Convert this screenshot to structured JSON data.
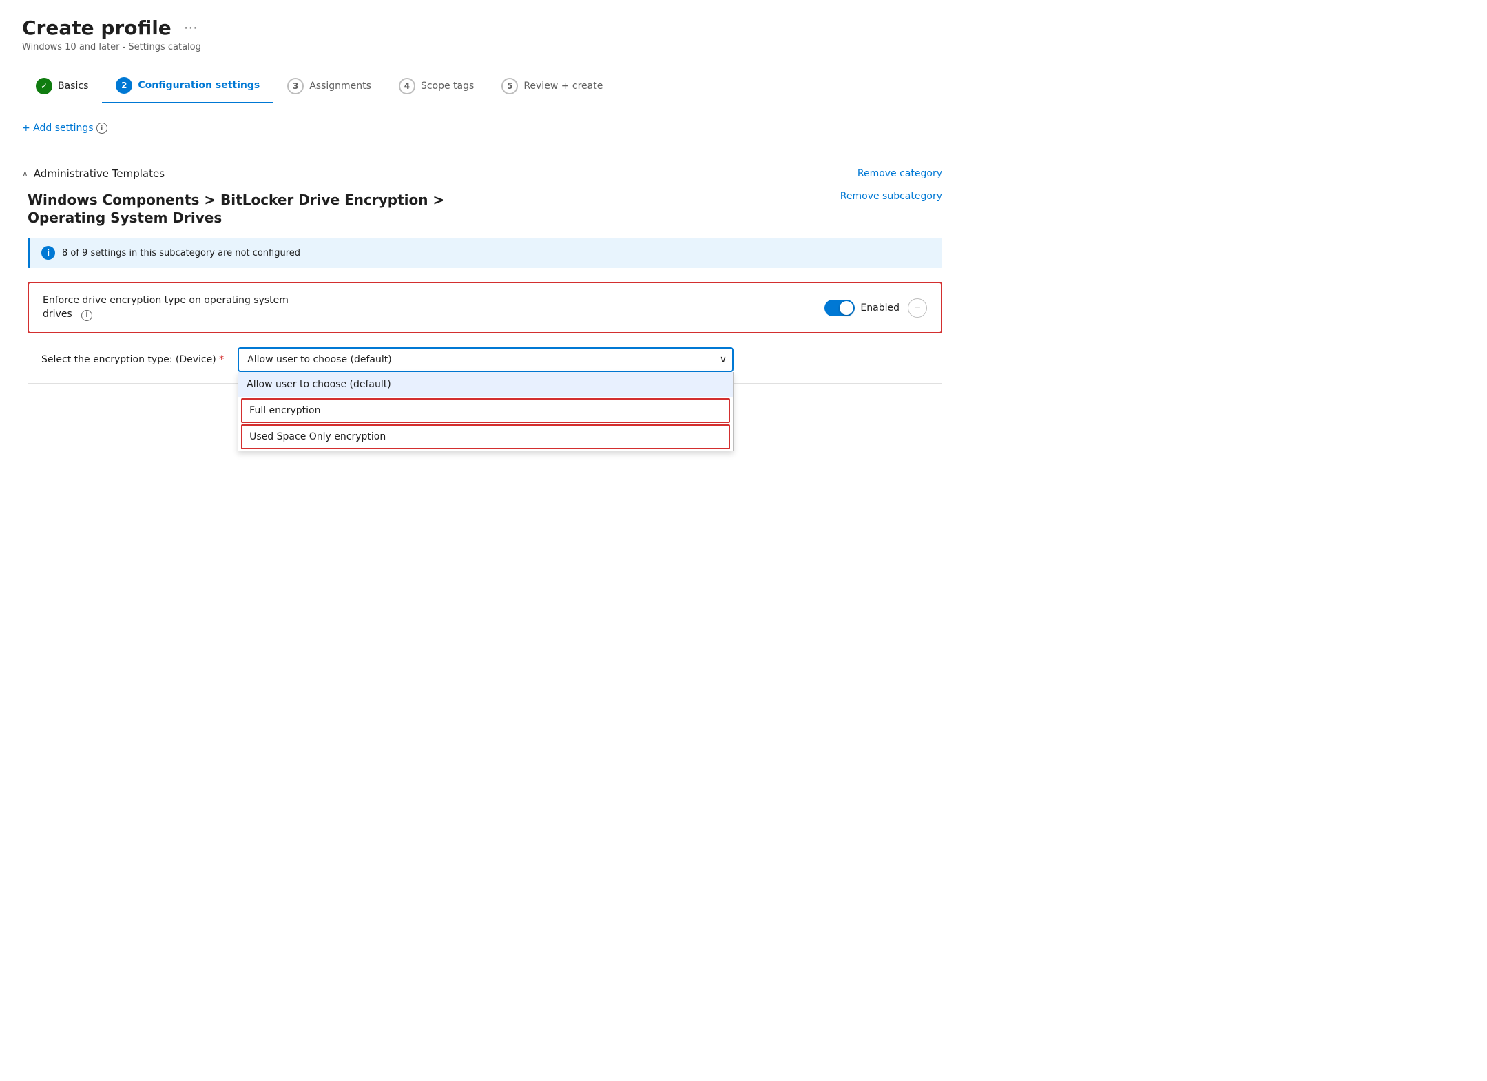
{
  "page": {
    "title": "Create profile",
    "subtitle": "Windows 10 and later - Settings catalog",
    "ellipsis_label": "···"
  },
  "wizard": {
    "steps": [
      {
        "id": "basics",
        "number": "✓",
        "label": "Basics",
        "state": "completed"
      },
      {
        "id": "configuration",
        "number": "2",
        "label": "Configuration settings",
        "state": "active"
      },
      {
        "id": "assignments",
        "number": "3",
        "label": "Assignments",
        "state": "inactive"
      },
      {
        "id": "scope",
        "number": "4",
        "label": "Scope tags",
        "state": "inactive"
      },
      {
        "id": "review",
        "number": "5",
        "label": "Review + create",
        "state": "inactive"
      }
    ]
  },
  "add_settings": {
    "label": "+ Add settings"
  },
  "category": {
    "name": "Administrative Templates",
    "remove_label": "Remove category",
    "chevron": "∧"
  },
  "subcategory": {
    "title": "Windows Components > BitLocker Drive Encryption > Operating System Drives",
    "remove_label": "Remove subcategory"
  },
  "info_banner": {
    "text": "8 of 9 settings in this subcategory are not configured"
  },
  "setting": {
    "label": "Enforce drive encryption type on operating system drives",
    "toggle_state": "Enabled",
    "is_enabled": true
  },
  "encryption_type": {
    "label": "Select the encryption type: (Device)",
    "required": true,
    "selected_value": "Allow user to choose (default)",
    "options": [
      {
        "id": "allow",
        "label": "Allow user to choose (default)",
        "selected": true,
        "highlighted": false
      },
      {
        "id": "full",
        "label": "Full encryption",
        "selected": false,
        "highlighted": true
      },
      {
        "id": "used_space",
        "label": "Used Space Only encryption",
        "selected": false,
        "highlighted": true
      }
    ]
  },
  "icons": {
    "info": "i",
    "chevron_down": "∨",
    "minimize": "−",
    "ellipsis": "···"
  }
}
